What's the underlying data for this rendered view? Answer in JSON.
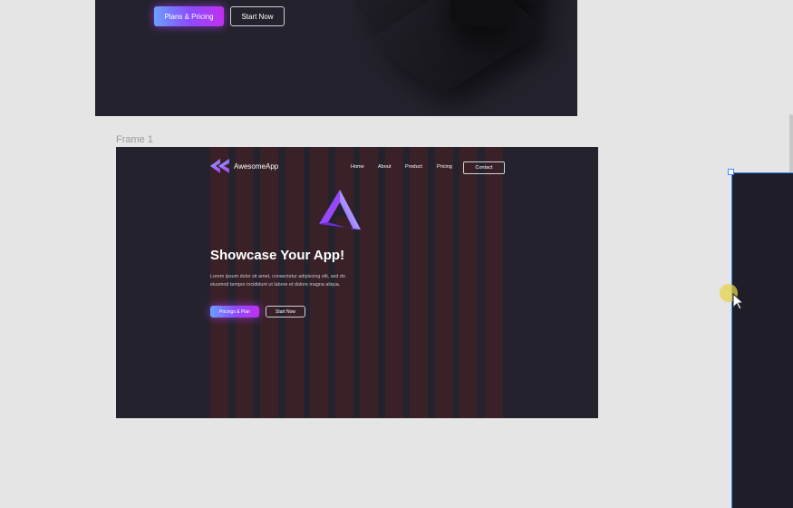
{
  "top_frame": {
    "primary_button": "Plans & Pricing",
    "secondary_button": "Start Now"
  },
  "frame_label": "Frame 1",
  "frame1": {
    "logo_text": "AwesomeApp",
    "nav": [
      "Home",
      "About",
      "Product",
      "Pricing"
    ],
    "contact_button": "Contact",
    "headline": "Showcase Your App!",
    "body": "Lorem ipsum dolor sit amet, consectetur adipiscing elit, sed do eiusmod tempor incididunt ut labore et dolore magna aliqua.",
    "primary_button": "Pricings & Plan",
    "secondary_button": "Start Now"
  },
  "colors": {
    "canvas": "#e5e5e5",
    "frame_bg": "#24232d",
    "grid_column": "#3a2128",
    "selection": "#3d8af7",
    "accent_purple": "#8a4dff",
    "accent_magenta": "#c12ff0",
    "cursor_highlight": "#e6d24a"
  },
  "icons": {
    "logo": "double-chevron-left-logo",
    "hero": "impossible-triangle-graphic",
    "cursor": "pointer-cursor"
  }
}
